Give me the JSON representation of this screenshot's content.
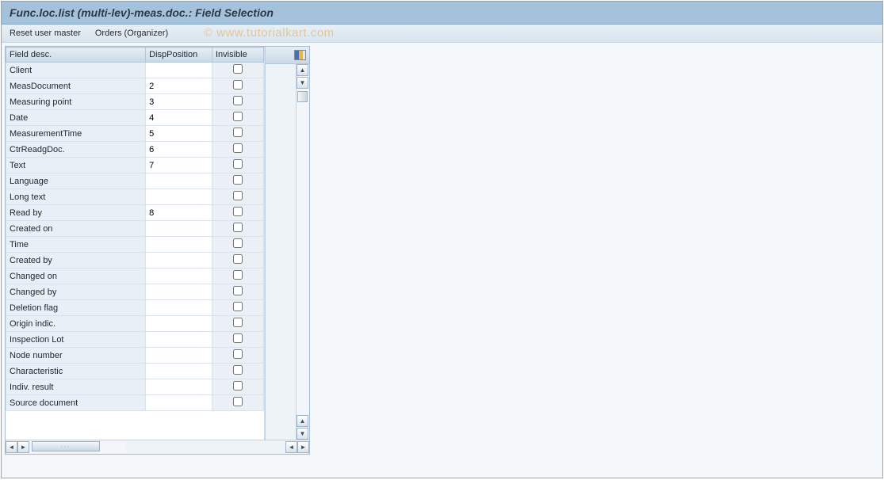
{
  "title": "Func.loc.list (multi-lev)-meas.doc.: Field Selection",
  "toolbar": {
    "reset_label": "Reset user master",
    "orders_label": "Orders (Organizer)"
  },
  "watermark": "© www.tutorialkart.com",
  "columns": {
    "field_desc": "Field desc.",
    "disp_position": "DispPosition",
    "invisible": "Invisible"
  },
  "rows": [
    {
      "fd": "Client",
      "dp": "",
      "iv": false
    },
    {
      "fd": "MeasDocument",
      "dp": "2",
      "iv": false
    },
    {
      "fd": "Measuring point",
      "dp": "3",
      "iv": false
    },
    {
      "fd": "Date",
      "dp": "4",
      "iv": false
    },
    {
      "fd": "MeasurementTime",
      "dp": "5",
      "iv": false
    },
    {
      "fd": "CtrReadgDoc.",
      "dp": "6",
      "iv": false
    },
    {
      "fd": "Text",
      "dp": "7",
      "iv": false
    },
    {
      "fd": "Language",
      "dp": "",
      "iv": false
    },
    {
      "fd": "Long text",
      "dp": "",
      "iv": false
    },
    {
      "fd": "Read by",
      "dp": "8",
      "iv": false
    },
    {
      "fd": "Created on",
      "dp": "",
      "iv": false
    },
    {
      "fd": "Time",
      "dp": "",
      "iv": false
    },
    {
      "fd": "Created by",
      "dp": "",
      "iv": false
    },
    {
      "fd": "Changed on",
      "dp": "",
      "iv": false
    },
    {
      "fd": "Changed by",
      "dp": "",
      "iv": false
    },
    {
      "fd": "Deletion flag",
      "dp": "",
      "iv": false
    },
    {
      "fd": "Origin indic.",
      "dp": "",
      "iv": false
    },
    {
      "fd": "Inspection Lot",
      "dp": "",
      "iv": false
    },
    {
      "fd": "Node number",
      "dp": "",
      "iv": false
    },
    {
      "fd": "Characteristic",
      "dp": "",
      "iv": false
    },
    {
      "fd": "Indiv. result",
      "dp": "",
      "iv": false
    },
    {
      "fd": "Source document",
      "dp": "",
      "iv": false
    }
  ]
}
